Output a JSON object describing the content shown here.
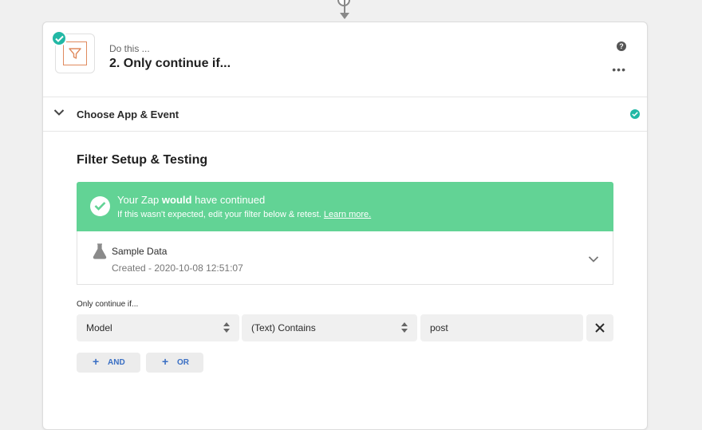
{
  "step": {
    "kicker": "Do this ...",
    "title": "2. Only continue if..."
  },
  "icons": {
    "help": "help-circle-icon",
    "more": "more-horizontal-icon",
    "filter": "filter-icon"
  },
  "section": {
    "label": "Choose App & Event"
  },
  "setup": {
    "title": "Filter Setup & Testing",
    "banner": {
      "line1_pre": "Your Zap ",
      "line1_bold": "would",
      "line1_post": " have continued",
      "line2": "If this wasn't expected, edit your filter below & retest. ",
      "link": "Learn more."
    },
    "sample": {
      "title": "Sample Data",
      "created": "Created - 2020-10-08 12:51:07"
    },
    "condition_label": "Only continue if...",
    "condition": {
      "field": "Model",
      "operator": "(Text) Contains",
      "value": "post"
    },
    "and_label": "AND",
    "or_label": "OR"
  },
  "colors": {
    "success": "#62d395",
    "teal": "#22b8a5",
    "link_blue": "#3a6fc4",
    "filter_orange": "#e08a5e"
  }
}
